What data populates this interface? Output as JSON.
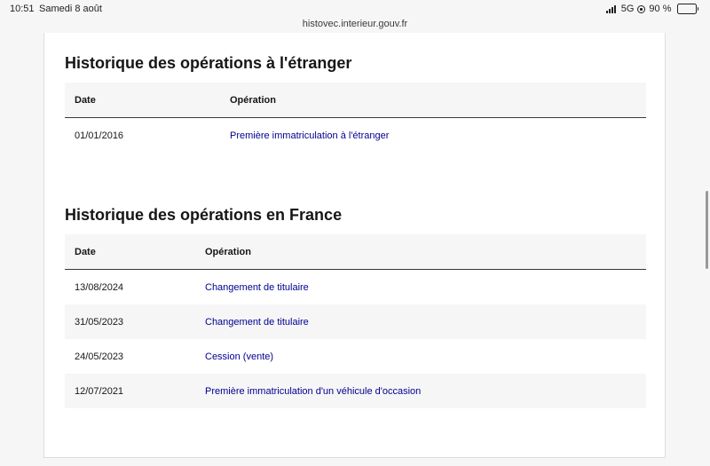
{
  "status_bar": {
    "time": "10:51",
    "date": "Samedi 8 août",
    "network": "5G",
    "battery": "90 %",
    "battery_level": 0.9
  },
  "browser": {
    "url": "histovec.interieur.gouv.fr"
  },
  "foreign_section": {
    "title": "Historique des opérations à l'étranger",
    "headers": {
      "date": "Date",
      "operation": "Opération"
    },
    "rows": [
      {
        "date": "01/01/2016",
        "operation": "Première immatriculation à l'étranger"
      }
    ]
  },
  "france_section": {
    "title": "Historique des opérations en France",
    "headers": {
      "date": "Date",
      "operation": "Opération"
    },
    "rows": [
      {
        "date": "13/08/2024",
        "operation": "Changement de titulaire"
      },
      {
        "date": "31/05/2023",
        "operation": "Changement de titulaire"
      },
      {
        "date": "24/05/2023",
        "operation": "Cession (vente)"
      },
      {
        "date": "12/07/2021",
        "operation": "Première immatriculation d'un véhicule d'occasion"
      }
    ]
  },
  "colors": {
    "link": "#000091",
    "header_bg": "#f6f6f6",
    "text": "#161616"
  }
}
